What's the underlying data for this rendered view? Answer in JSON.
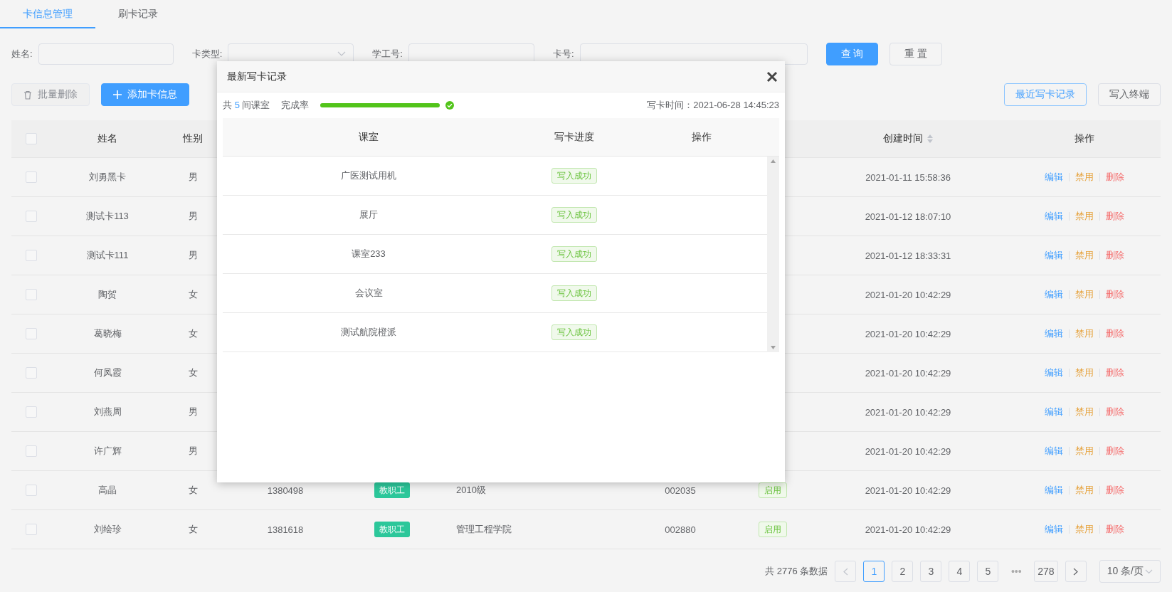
{
  "tabs": [
    {
      "label": "卡信息管理",
      "selected": true
    },
    {
      "label": "刷卡记录",
      "selected": false
    }
  ],
  "filters": [
    {
      "label": "姓名:",
      "kind": "input"
    },
    {
      "label": "卡类型:",
      "kind": "select"
    },
    {
      "label": "学工号:",
      "kind": "input"
    },
    {
      "label": "卡号:",
      "kind": "input"
    }
  ],
  "search_buttons": [
    {
      "label": "查 询",
      "kind": "primary"
    },
    {
      "label": "重 置",
      "kind": "default"
    }
  ],
  "toolbar_left": [
    {
      "label": "批量删除",
      "kind": "delete",
      "disabled": true
    },
    {
      "label": "添加卡信息",
      "kind": "add",
      "disabled": false
    }
  ],
  "toolbar_right": [
    {
      "label": "最近写卡记录",
      "kind": "outline"
    },
    {
      "label": "写入终端",
      "kind": "default"
    }
  ],
  "table": {
    "select_all": false,
    "columns": [
      {
        "label": "姓名"
      },
      {
        "label": "性别"
      },
      {
        "label": "创建时间",
        "sortable": true
      },
      {
        "label": "操作"
      }
    ],
    "rows": [
      {
        "checked": false,
        "name": "刘勇黑卡",
        "gender": "男",
        "created": "2021-01-11 15:58:36",
        "actions": [
          {
            "label": "编辑",
            "kind": "edit"
          },
          {
            "label": "禁用",
            "kind": "disable"
          },
          {
            "label": "删除",
            "kind": "delete"
          }
        ]
      },
      {
        "checked": false,
        "name": "测试卡113",
        "gender": "男",
        "created": "2021-01-12 18:07:10",
        "actions": [
          {
            "label": "编辑",
            "kind": "edit"
          },
          {
            "label": "禁用",
            "kind": "disable"
          },
          {
            "label": "删除",
            "kind": "delete"
          }
        ]
      },
      {
        "checked": false,
        "name": "测试卡111",
        "gender": "男",
        "created": "2021-01-12 18:33:31",
        "actions": [
          {
            "label": "编辑",
            "kind": "edit"
          },
          {
            "label": "禁用",
            "kind": "disable"
          },
          {
            "label": "删除",
            "kind": "delete"
          }
        ]
      },
      {
        "checked": false,
        "name": "陶贺",
        "gender": "女",
        "created": "2021-01-20 10:42:29",
        "actions": [
          {
            "label": "编辑",
            "kind": "edit"
          },
          {
            "label": "禁用",
            "kind": "disable"
          },
          {
            "label": "删除",
            "kind": "delete"
          }
        ]
      },
      {
        "checked": false,
        "name": "葛晓梅",
        "gender": "女",
        "created": "2021-01-20 10:42:29",
        "actions": [
          {
            "label": "编辑",
            "kind": "edit"
          },
          {
            "label": "禁用",
            "kind": "disable"
          },
          {
            "label": "删除",
            "kind": "delete"
          }
        ]
      },
      {
        "checked": false,
        "name": "何凤霞",
        "gender": "女",
        "created": "2021-01-20 10:42:29",
        "actions": [
          {
            "label": "编辑",
            "kind": "edit"
          },
          {
            "label": "禁用",
            "kind": "disable"
          },
          {
            "label": "删除",
            "kind": "delete"
          }
        ]
      },
      {
        "checked": false,
        "name": "刘燕周",
        "gender": "男",
        "created": "2021-01-20 10:42:29",
        "actions": [
          {
            "label": "编辑",
            "kind": "edit"
          },
          {
            "label": "禁用",
            "kind": "disable"
          },
          {
            "label": "删除",
            "kind": "delete"
          }
        ]
      },
      {
        "checked": false,
        "name": "许广辉",
        "gender": "男",
        "created": "2021-01-20 10:42:29",
        "actions": [
          {
            "label": "编辑",
            "kind": "edit"
          },
          {
            "label": "禁用",
            "kind": "disable"
          },
          {
            "label": "删除",
            "kind": "delete"
          }
        ]
      },
      {
        "checked": false,
        "name": "高晶",
        "gender": "女",
        "id_number": "1380498",
        "type": "教职工",
        "dept": "2010级",
        "card": "002035",
        "status": "启用",
        "created": "2021-01-20 10:42:29",
        "actions": [
          {
            "label": "编辑",
            "kind": "edit"
          },
          {
            "label": "禁用",
            "kind": "disable"
          },
          {
            "label": "删除",
            "kind": "delete"
          }
        ]
      },
      {
        "checked": false,
        "name": "刘绘珍",
        "gender": "女",
        "id_number": "1381618",
        "type": "教职工",
        "dept": "管理工程学院",
        "card": "002880",
        "status": "启用",
        "created": "2021-01-20 10:42:29",
        "actions": [
          {
            "label": "编辑",
            "kind": "edit"
          },
          {
            "label": "禁用",
            "kind": "disable"
          },
          {
            "label": "删除",
            "kind": "delete"
          }
        ]
      }
    ]
  },
  "pagination": {
    "total": "共 2776 条数据",
    "pages": [
      {
        "label": "1",
        "selected": true
      },
      {
        "label": "2",
        "selected": false
      },
      {
        "label": "3",
        "selected": false
      },
      {
        "label": "4",
        "selected": false
      },
      {
        "label": "5",
        "selected": false
      },
      {
        "label": "•••",
        "kind": "ellipsis"
      },
      {
        "label": "278",
        "selected": false
      }
    ],
    "page_size": "10 条/页"
  },
  "dialog": {
    "title": "最新写卡记录",
    "summary_prefix": "共",
    "count": "5",
    "summary_suffix": "间课室",
    "rate_label": "完成率",
    "level": 1,
    "write_time": "写卡时间：2021-06-28 14:45:23",
    "columns": [
      "课室",
      "写卡进度",
      "操作"
    ],
    "rows": [
      {
        "room": "广医测试用机",
        "status": "写入成功",
        "kind": "success"
      },
      {
        "room": "展厅",
        "status": "写入成功",
        "kind": "success"
      },
      {
        "room": "课室233",
        "status": "写入成功",
        "kind": "success"
      },
      {
        "room": "会议室",
        "status": "写入成功",
        "kind": "success"
      },
      {
        "room": "测试航院橙派",
        "status": "写入成功",
        "kind": "success"
      }
    ]
  }
}
